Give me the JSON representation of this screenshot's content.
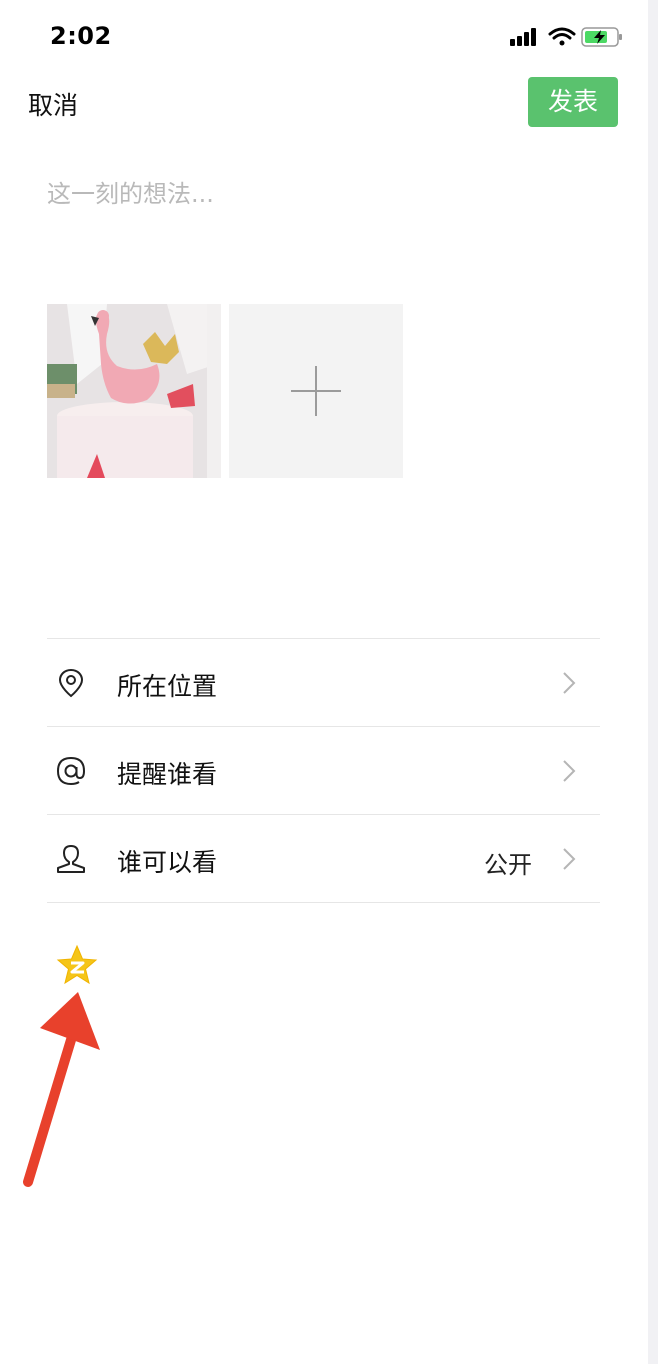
{
  "status_bar": {
    "time": "2:02",
    "icons": [
      "signal-icon",
      "wifi-icon",
      "battery-charging-icon"
    ],
    "battery_color": "#4cd964"
  },
  "header": {
    "cancel_label": "取消",
    "publish_label": "发表",
    "accent": "#5ac26e"
  },
  "composer": {
    "placeholder": "这一刻的想法..."
  },
  "photos": {
    "thumbnail": "flamingo-cake-photo",
    "add_icon": "plus-icon"
  },
  "options": [
    {
      "icon": "location-pin-icon",
      "label": "所在位置",
      "value": ""
    },
    {
      "icon": "at-sign-icon",
      "label": "提醒谁看",
      "value": ""
    },
    {
      "icon": "person-icon",
      "label": "谁可以看",
      "value": "公开"
    }
  ],
  "share": {
    "icon": "qzone-star-icon",
    "star_color": "#f5c518"
  },
  "annotation": {
    "arrow_color": "#e8412c"
  }
}
